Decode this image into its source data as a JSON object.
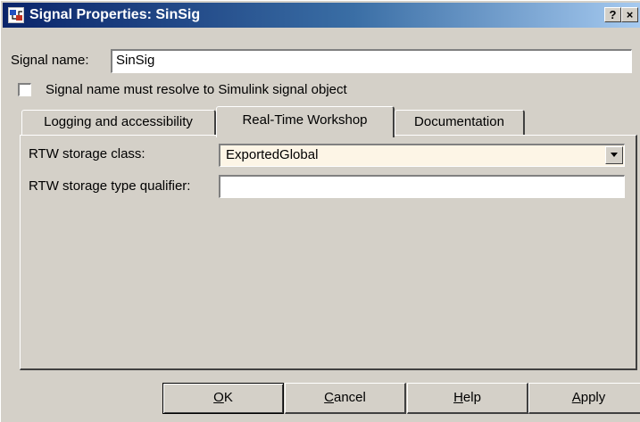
{
  "window": {
    "title": "Signal Properties: SinSig",
    "help_button": "?",
    "close_button": "×"
  },
  "signal_name": {
    "label": "Signal name:",
    "value": "SinSig"
  },
  "resolve_checkbox": {
    "label": "Signal name must resolve to Simulink signal object",
    "checked": false
  },
  "tabs": [
    {
      "label": "Logging and accessibility",
      "active": false
    },
    {
      "label": "Real-Time Workshop",
      "active": true
    },
    {
      "label": "Documentation",
      "active": false
    }
  ],
  "rtw": {
    "storage_class_label": "RTW storage class:",
    "storage_class_value": "ExportedGlobal",
    "type_qualifier_label": "RTW storage type qualifier:",
    "type_qualifier_value": ""
  },
  "buttons": {
    "ok": "OK",
    "cancel": "Cancel",
    "help": "Help",
    "apply": "Apply"
  },
  "colors": {
    "dialog_background": "#d4d0c8",
    "titlebar_start": "#0a246a",
    "titlebar_end": "#a6caf0",
    "dropdown_background": "#fdf5e6"
  }
}
